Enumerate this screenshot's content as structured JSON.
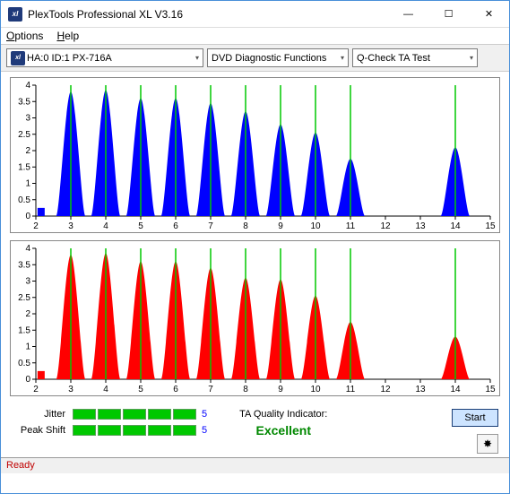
{
  "window": {
    "title": "PlexTools Professional XL V3.16",
    "icon_text": "xl"
  },
  "menu": {
    "options": "Options",
    "help": "Help"
  },
  "toolbar": {
    "drive": "HA:0 ID:1  PX-716A",
    "func": "DVD Diagnostic Functions",
    "test": "Q-Check TA Test"
  },
  "meters": {
    "jitter_label": "Jitter",
    "jitter_value": "5",
    "peak_label": "Peak Shift",
    "peak_value": "5"
  },
  "quality": {
    "label": "TA Quality Indicator:",
    "value": "Excellent"
  },
  "buttons": {
    "start": "Start"
  },
  "status": "Ready",
  "chart_data": [
    {
      "type": "bar",
      "color": "#0000ff",
      "xlabel": "",
      "ylabel": "",
      "xlim": [
        2,
        15
      ],
      "ylim": [
        0,
        4
      ],
      "xticks": [
        2,
        3,
        4,
        5,
        6,
        7,
        8,
        9,
        10,
        11,
        12,
        13,
        14,
        15
      ],
      "yticks": [
        0,
        0.5,
        1,
        1.5,
        2,
        2.5,
        3,
        3.5,
        4
      ],
      "markers_x": [
        3,
        4,
        5,
        6,
        7,
        8,
        9,
        10,
        11,
        14
      ],
      "peaks": [
        {
          "x": 3,
          "y": 3.8
        },
        {
          "x": 4,
          "y": 3.85
        },
        {
          "x": 5,
          "y": 3.6
        },
        {
          "x": 6,
          "y": 3.6
        },
        {
          "x": 7,
          "y": 3.45
        },
        {
          "x": 8,
          "y": 3.2
        },
        {
          "x": 9,
          "y": 2.8
        },
        {
          "x": 10,
          "y": 2.55
        },
        {
          "x": 11,
          "y": 1.75
        },
        {
          "x": 14,
          "y": 2.1
        }
      ]
    },
    {
      "type": "bar",
      "color": "#ff0000",
      "xlabel": "",
      "ylabel": "",
      "xlim": [
        2,
        15
      ],
      "ylim": [
        0,
        4
      ],
      "xticks": [
        2,
        3,
        4,
        5,
        6,
        7,
        8,
        9,
        10,
        11,
        12,
        13,
        14,
        15
      ],
      "yticks": [
        0,
        0.5,
        1,
        1.5,
        2,
        2.5,
        3,
        3.5,
        4
      ],
      "markers_x": [
        3,
        4,
        5,
        6,
        7,
        8,
        9,
        10,
        11,
        14
      ],
      "peaks": [
        {
          "x": 3,
          "y": 3.8
        },
        {
          "x": 4,
          "y": 3.85
        },
        {
          "x": 5,
          "y": 3.6
        },
        {
          "x": 6,
          "y": 3.6
        },
        {
          "x": 7,
          "y": 3.4
        },
        {
          "x": 8,
          "y": 3.1
        },
        {
          "x": 9,
          "y": 3.05
        },
        {
          "x": 10,
          "y": 2.55
        },
        {
          "x": 11,
          "y": 1.75
        },
        {
          "x": 14,
          "y": 1.3
        }
      ]
    }
  ]
}
